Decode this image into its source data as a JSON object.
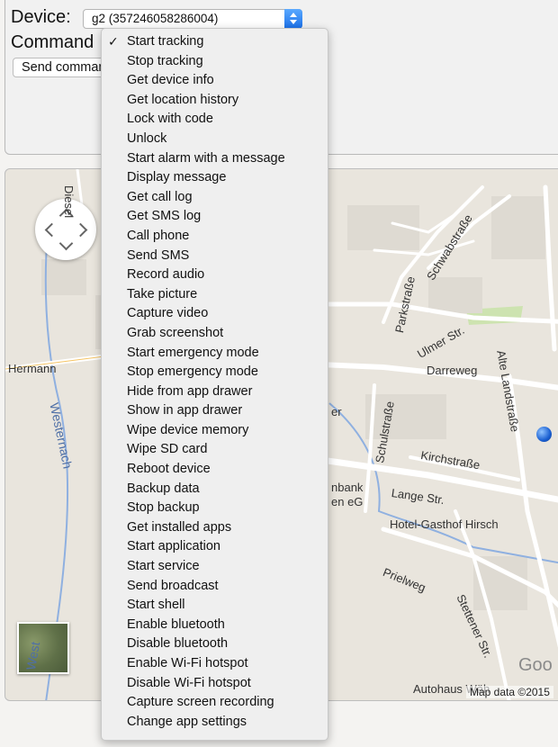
{
  "form": {
    "device_label": "Device:",
    "device_value": "g2 (357246058286004)",
    "command_label": "Command",
    "send_label": "Send command"
  },
  "menu": {
    "selected_index": 0,
    "items": [
      {
        "label": "Start tracking"
      },
      {
        "label": "Stop tracking"
      },
      {
        "label": "Get device info"
      },
      {
        "label": "Get location history"
      },
      {
        "label": "Lock with code"
      },
      {
        "label": "Unlock"
      },
      {
        "label": "Start alarm with a message"
      },
      {
        "label": "Display message"
      },
      {
        "label": "Get call log"
      },
      {
        "label": "Get SMS log"
      },
      {
        "label": "Call phone"
      },
      {
        "label": "Send SMS"
      },
      {
        "label": "Record audio"
      },
      {
        "label": "Take picture"
      },
      {
        "label": "Capture video"
      },
      {
        "label": "Grab screenshot"
      },
      {
        "label": "Start emergency mode"
      },
      {
        "label": "Stop emergency mode"
      },
      {
        "label": "Hide from app drawer"
      },
      {
        "label": "Show in app drawer"
      },
      {
        "label": "Wipe device memory"
      },
      {
        "label": "Wipe SD card"
      },
      {
        "label": "Reboot device"
      },
      {
        "label": "Backup data"
      },
      {
        "label": "Stop backup"
      },
      {
        "label": "Get installed apps"
      },
      {
        "label": "Start application"
      },
      {
        "label": "Start service"
      },
      {
        "label": "Send broadcast"
      },
      {
        "label": "Start shell"
      },
      {
        "label": "Enable bluetooth"
      },
      {
        "label": "Disable bluetooth"
      },
      {
        "label": "Enable Wi-Fi hotspot"
      },
      {
        "label": "Disable Wi-Fi hotspot"
      },
      {
        "label": "Capture screen recording"
      },
      {
        "label": "Change app settings"
      }
    ]
  },
  "map": {
    "labels": {
      "diesel": "Diesel",
      "hermann": "Hermann",
      "westernach": "Westernach",
      "westernach_bottom": "West",
      "schwabstrasse": "Schwabstraße",
      "parkstrasse": "Parkstraße",
      "ulmer": "Ulmer Str.",
      "alte_landstrasse": "Alte Landstraße",
      "darreweg": "Darreweg",
      "er": "er",
      "schulstrasse": "Schulstraße",
      "kirchstrasse": "Kirchstraße",
      "nbank": "nbank",
      "en_eg": "en eG",
      "lange": "Lange Str.",
      "hotel": "Hotel-Gasthof Hirsch",
      "prielweg": "Prielweg",
      "stettener": "Stettener Str.",
      "autohaus": "Autohaus Wäh",
      "map_data": "Map data ©2015",
      "google": "Goo"
    },
    "marker_color": "#1a5fd1"
  }
}
